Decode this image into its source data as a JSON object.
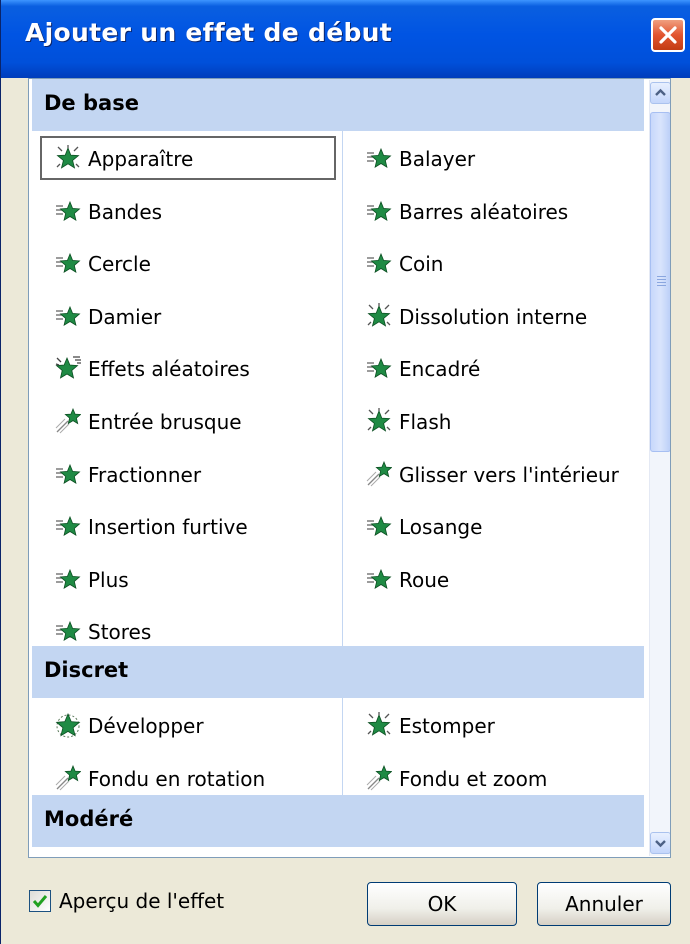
{
  "window": {
    "title": "Ajouter un effet de début"
  },
  "sections": [
    {
      "name": "De base",
      "items": [
        {
          "label": "Apparaître",
          "icon": "star-appear-icon"
        },
        {
          "label": "Balayer",
          "icon": "star-wipe-icon"
        },
        {
          "label": "Bandes",
          "icon": "star-wipe-icon"
        },
        {
          "label": "Barres aléatoires",
          "icon": "star-wipe-icon"
        },
        {
          "label": "Cercle",
          "icon": "star-wipe-icon"
        },
        {
          "label": "Coin",
          "icon": "star-wipe-icon"
        },
        {
          "label": "Damier",
          "icon": "star-wipe-icon"
        },
        {
          "label": "Dissolution interne",
          "icon": "star-appear-icon"
        },
        {
          "label": "Effets aléatoires",
          "icon": "star-random-icon"
        },
        {
          "label": "Encadré",
          "icon": "star-wipe-icon"
        },
        {
          "label": "Entrée brusque",
          "icon": "star-fly-icon"
        },
        {
          "label": "Flash",
          "icon": "star-appear-icon"
        },
        {
          "label": "Fractionner",
          "icon": "star-wipe-icon"
        },
        {
          "label": "Glisser vers l'intérieur",
          "icon": "star-fly-icon"
        },
        {
          "label": "Insertion furtive",
          "icon": "star-wipe-icon"
        },
        {
          "label": "Losange",
          "icon": "star-wipe-icon"
        },
        {
          "label": "Plus",
          "icon": "star-wipe-icon"
        },
        {
          "label": "Roue",
          "icon": "star-wipe-icon"
        },
        {
          "label": "Stores",
          "icon": "star-wipe-icon"
        }
      ]
    },
    {
      "name": "Discret",
      "items": [
        {
          "label": "Développer",
          "icon": "star-expand-icon"
        },
        {
          "label": "Estomper",
          "icon": "star-appear-icon"
        },
        {
          "label": "Fondu en rotation",
          "icon": "star-fly-icon"
        },
        {
          "label": "Fondu et zoom",
          "icon": "star-fly-icon"
        }
      ]
    },
    {
      "name": "Modéré",
      "items": []
    }
  ],
  "selected_item": "Apparaître",
  "preview_checkbox": {
    "label": "Aperçu de l'effet",
    "checked": true
  },
  "buttons": {
    "ok": "OK",
    "cancel": "Annuler"
  },
  "colors": {
    "titlebar": "#0054e3",
    "section_header": "#c3d6f2",
    "star_green": "#1f8a44",
    "dialog_bg": "#ece9d8"
  }
}
